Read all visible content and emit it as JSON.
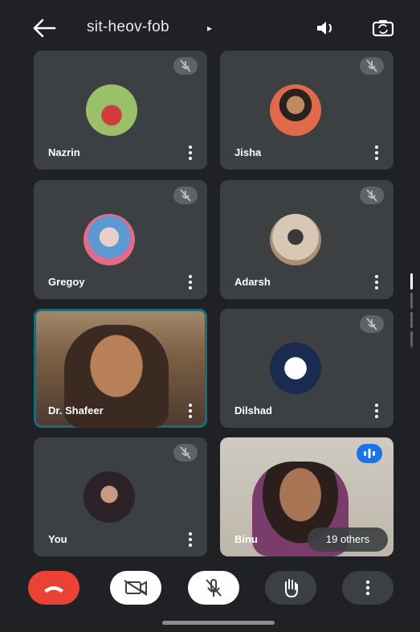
{
  "header": {
    "meeting_code": "sit-heov-fob",
    "caret": "▸",
    "back_icon": "arrow-back-icon",
    "speaker_icon": "speaker-icon",
    "flip_icon": "flip-camera-icon"
  },
  "participants": [
    {
      "name": "Nazrin",
      "muted": true
    },
    {
      "name": "Jisha",
      "muted": true
    },
    {
      "name": "Gregoy",
      "muted": true
    },
    {
      "name": "Adarsh",
      "muted": true
    },
    {
      "name": "Dr. Shafeer",
      "muted": false,
      "video": true
    },
    {
      "name": "Dilshad",
      "muted": true
    },
    {
      "name": "You",
      "muted": true
    },
    {
      "name": "Binu",
      "muted": false,
      "video": true
    }
  ],
  "others_badge": "19 others",
  "controls": {
    "end_call": "end-call-icon",
    "camera": "camera-off-icon",
    "mic": "mic-off-icon",
    "raise_hand": "raise-hand-icon",
    "more": "more-vert-icon"
  },
  "colors": {
    "background": "#202124",
    "tile": "#3c4043",
    "end_call": "#ea4335",
    "active_border": "#1e6a78",
    "speaking": "#1a73e8"
  }
}
